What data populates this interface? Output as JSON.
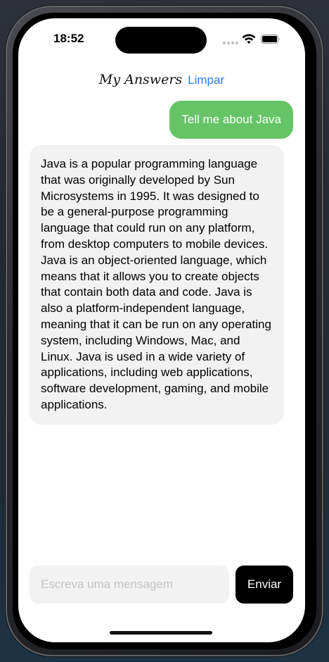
{
  "status_bar": {
    "time": "18:52",
    "icons": [
      "signal-dots-icon",
      "wifi-icon",
      "battery-icon"
    ]
  },
  "header": {
    "title": "My Answers",
    "clear_label": "Limpar"
  },
  "messages": [
    {
      "role": "user",
      "text": "Tell me about Java"
    },
    {
      "role": "assistant",
      "text": "Java is a popular programming language that was originally developed by Sun Microsystems in 1995. It was designed to be a general-purpose programming language that could run on any platform, from desktop computers to mobile devices. Java is an object-oriented language, which means that it allows you to create objects that contain both data and code. Java is also a platform-independent language, meaning that it can be run on any operating system, including Windows, Mac, and Linux. Java is used in a wide variety of applications, including web applications, software development, gaming, and mobile applications."
    }
  ],
  "composer": {
    "input_value": "",
    "placeholder": "Escreva uma mensagem",
    "send_label": "Enviar"
  },
  "colors": {
    "user_bubble": "#65c466",
    "assistant_bubble": "#f2f2f2",
    "link": "#2f7cf6",
    "send_button": "#000000",
    "screen_background": "#ffffff"
  }
}
